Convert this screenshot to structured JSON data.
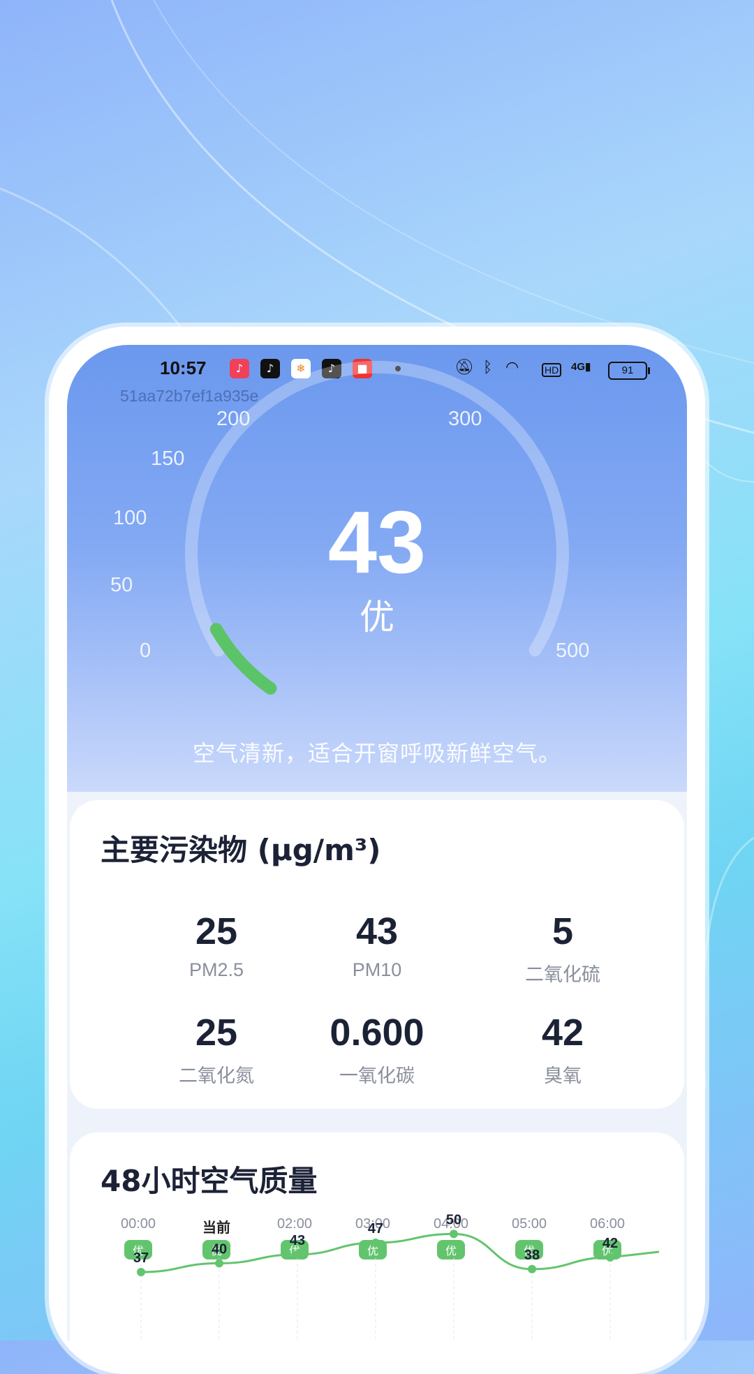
{
  "status_bar": {
    "time": "10:57",
    "battery": "91",
    "network": "4G"
  },
  "device_id": "51aa72b7ef1a935e",
  "gauge": {
    "ticks": [
      "0",
      "50",
      "100",
      "150",
      "200",
      "300",
      "500"
    ],
    "value": "43",
    "level": "优",
    "fill_fraction": 0.086,
    "fill_color": "#5cc468"
  },
  "advice": "空气清新，适合开窗呼吸新鲜空气。",
  "pollutants": {
    "title": "主要污染物 (µg/m³)",
    "items": [
      {
        "value": "25",
        "name": "PM2.5"
      },
      {
        "value": "43",
        "name": "PM10"
      },
      {
        "value": "5",
        "name": "二氧化硫"
      },
      {
        "value": "25",
        "name": "二氧化氮"
      },
      {
        "value": "0.600",
        "name": "一氧化碳"
      },
      {
        "value": "42",
        "name": "臭氧"
      }
    ]
  },
  "hourly": {
    "title": "48小时空气质量",
    "hours": [
      {
        "time": "00:00",
        "level": "优",
        "aqi": 37
      },
      {
        "time": "当前",
        "level": "优",
        "aqi": 40
      },
      {
        "time": "02:00",
        "level": "优",
        "aqi": 43
      },
      {
        "time": "03:00",
        "level": "优",
        "aqi": 47
      },
      {
        "time": "04:00",
        "level": "优",
        "aqi": 50
      },
      {
        "time": "05:00",
        "level": "优",
        "aqi": 38
      },
      {
        "time": "06:00",
        "level": "优",
        "aqi": 42
      }
    ],
    "line_color": "#63c46e"
  },
  "colors": {
    "accent_green": "#63c46e",
    "hero_blue": "#6b98ee",
    "text_dark": "#1c2236"
  }
}
